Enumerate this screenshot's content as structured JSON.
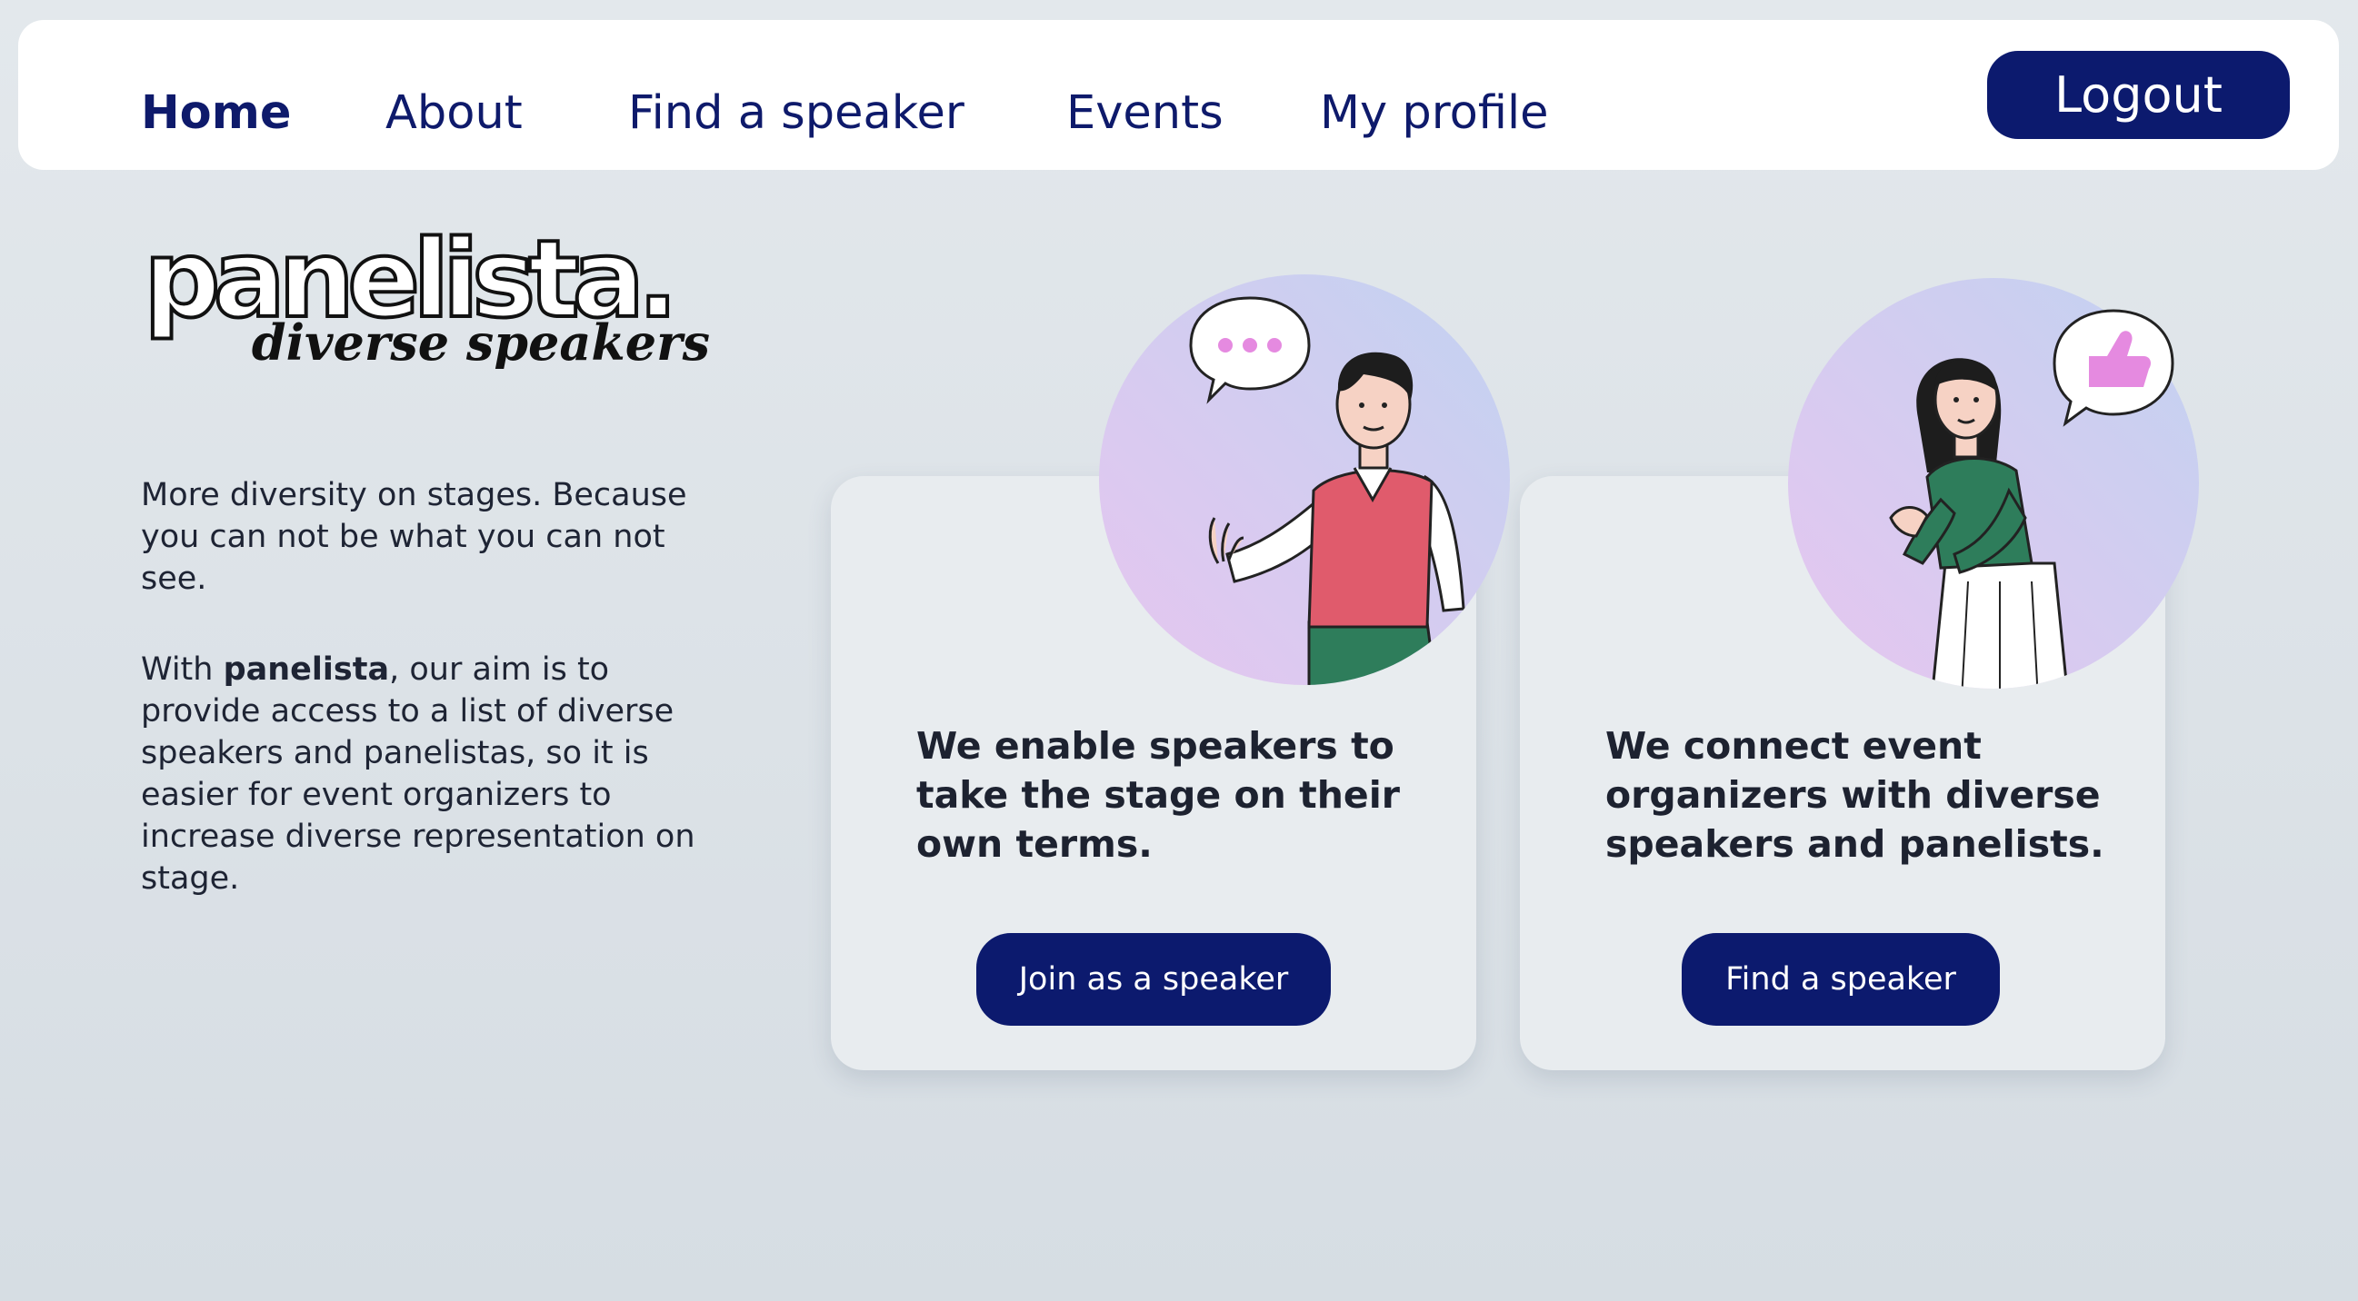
{
  "nav": {
    "items": [
      {
        "label": "Home",
        "active": true
      },
      {
        "label": "About",
        "active": false
      },
      {
        "label": "Find a speaker",
        "active": false
      },
      {
        "label": "Events",
        "active": false
      },
      {
        "label": "My profile",
        "active": false
      }
    ],
    "logout_label": "Logout"
  },
  "logo": {
    "wordmark": "panelista.",
    "tagline": "diverse speakers"
  },
  "intro": {
    "paragraph1": "More diversity on stages. Because you can not be what you can not see.",
    "paragraph2_prefix": "With ",
    "paragraph2_brand": "panelista",
    "paragraph2_suffix": ", our aim is to provide access to a list of diverse speakers and panelistas, so it is easier for event organizers to increase diverse representation on stage."
  },
  "cards": [
    {
      "title": "We enable speakers to take the stage on their own terms.",
      "button_label": "Join as a speaker",
      "icon": "speaker-man-illustration"
    },
    {
      "title": "We connect event organizers with diverse speakers and panelists.",
      "button_label": "Find a speaker",
      "icon": "organizer-woman-illustration"
    }
  ],
  "colors": {
    "primary": "#0c1a6e",
    "background": "#dfe5ea",
    "card": "#e8ecef",
    "accent_pink": "#e060c0"
  }
}
